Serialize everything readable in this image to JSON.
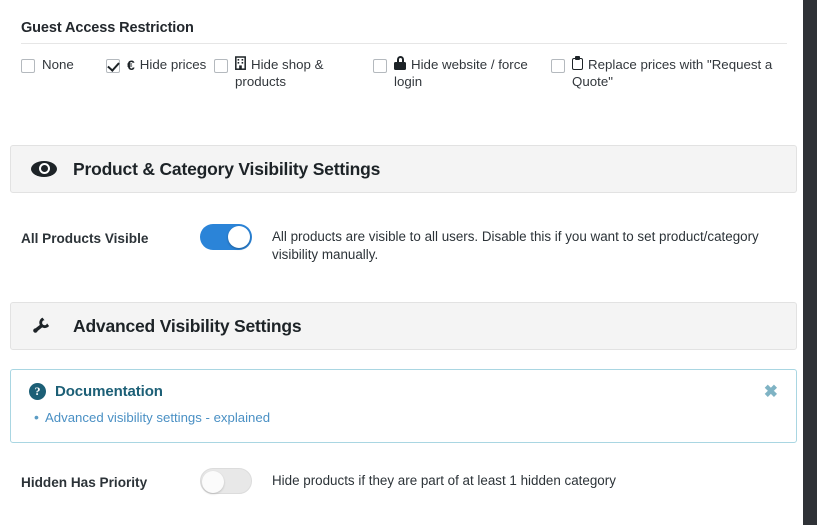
{
  "guest_access": {
    "title": "Guest Access Restriction",
    "options": [
      {
        "label": "None",
        "icon": "none",
        "checked": false
      },
      {
        "label": "Hide prices",
        "icon": "euro-icon",
        "checked": true
      },
      {
        "label": "Hide shop & products",
        "icon": "store-icon",
        "checked": false
      },
      {
        "label": "Hide website / force login",
        "icon": "lock-icon",
        "checked": false
      },
      {
        "label": "Replace prices with \"Request a Quote\"",
        "icon": "clipboard-icon",
        "checked": false
      }
    ]
  },
  "product_visibility_panel": {
    "icon": "eye-icon",
    "title": "Product & Category Visibility Settings",
    "setting": {
      "label": "All Products Visible",
      "toggle_state": "on",
      "description": "All products are visible to all users. Disable this if you want to set product/category visibility manually."
    }
  },
  "advanced_visibility_panel": {
    "icon": "wrench-icon",
    "title": "Advanced Visibility Settings",
    "documentation": {
      "icon": "question-circle-icon",
      "title": "Documentation",
      "close_label": "✖",
      "links": [
        {
          "label": "Advanced visibility settings - explained"
        }
      ]
    },
    "setting": {
      "label": "Hidden Has Priority",
      "toggle_state": "off",
      "description": "Hide products if they are part of at least 1 hidden category"
    }
  },
  "colors": {
    "toggle_on": "#2b84d8",
    "toggle_off": "#e8e8e8",
    "panel_bg": "#f4f4f4",
    "doc_border": "#a9d6e2",
    "doc_title": "#1c5f76",
    "doc_link": "#4a90c4",
    "rail": "#2f3237"
  }
}
